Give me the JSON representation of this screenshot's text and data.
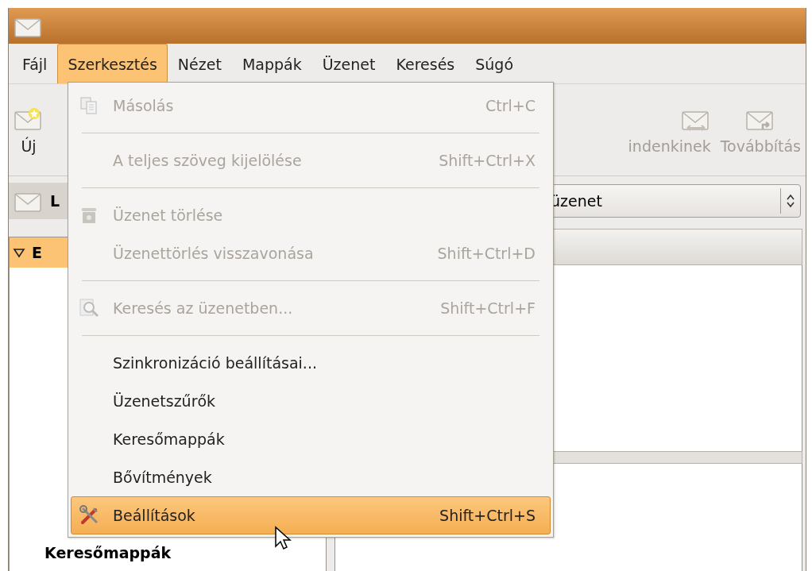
{
  "menubar": [
    {
      "label": "Fájl",
      "selected": false
    },
    {
      "label": "Szerkesztés",
      "selected": true
    },
    {
      "label": "Nézet",
      "selected": false
    },
    {
      "label": "Mappák",
      "selected": false
    },
    {
      "label": "Üzenet",
      "selected": false
    },
    {
      "label": "Keresés",
      "selected": false
    },
    {
      "label": "Súgó",
      "selected": false
    }
  ],
  "toolbar": {
    "buttons": [
      {
        "kind": "new",
        "label": "Új",
        "disabled": false
      },
      {
        "kind": "reply-all",
        "label": "indenkinek",
        "disabled": true
      },
      {
        "kind": "forward",
        "label": "Továbbítás",
        "disabled": true
      }
    ]
  },
  "view_bar": {
    "label": "L",
    "filter_value": "üzenet"
  },
  "folder_pane": {
    "header": {
      "label": "E",
      "expanded": true,
      "selected": true
    },
    "search_folders_label": "Keresőmappák"
  },
  "menu": {
    "items": [
      {
        "kind": "copy",
        "label": "Másolás",
        "shortcut": "Ctrl+C",
        "disabled": true,
        "selected": false
      },
      {
        "kind": "separator"
      },
      {
        "kind": "item",
        "label": "A teljes szöveg kijelölése",
        "shortcut": "Shift+Ctrl+X",
        "disabled": true,
        "selected": false
      },
      {
        "kind": "separator"
      },
      {
        "kind": "trash",
        "label": "Üzenet törlése",
        "disabled": true,
        "selected": false
      },
      {
        "kind": "item",
        "label": "Üzenettörlés visszavonása",
        "shortcut": "Shift+Ctrl+D",
        "disabled": true,
        "selected": false
      },
      {
        "kind": "separator"
      },
      {
        "kind": "search",
        "label": "Keresés az üzenetben...",
        "shortcut": "Shift+Ctrl+F",
        "disabled": true,
        "selected": false
      },
      {
        "kind": "separator"
      },
      {
        "kind": "item",
        "label": "Szinkronizáció beállításai...",
        "disabled": false,
        "selected": false
      },
      {
        "kind": "item",
        "label": "Üzenetszűrők",
        "disabled": false,
        "selected": false
      },
      {
        "kind": "item",
        "label": "Keresőmappák",
        "disabled": false,
        "selected": false
      },
      {
        "kind": "item",
        "label": "Bővítmények",
        "disabled": false,
        "selected": false
      },
      {
        "kind": "tools",
        "label": "Beállítások",
        "shortcut": "Shift+Ctrl+S",
        "disabled": false,
        "selected": true
      }
    ]
  }
}
